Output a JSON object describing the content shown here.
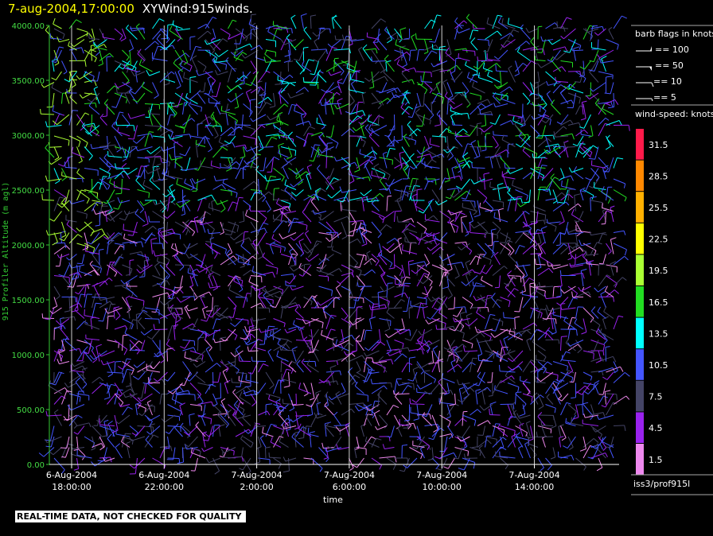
{
  "header": {
    "datetime": "7-aug-2004,17:00:00",
    "title": "XYWind:915winds."
  },
  "warning": "REAL-TIME DATA, NOT CHECKED FOR QUALITY",
  "station": "iss3/prof915l",
  "chart_data": {
    "type": "wind-barb",
    "xlabel": "time",
    "ylabel": "915 Profiler Altitude (m agl)",
    "ylim": [
      0,
      4000
    ],
    "y_ticks": [
      "0.00",
      "500.00",
      "1000.00",
      "1500.00",
      "2000.00",
      "2500.00",
      "3000.00",
      "3500.00",
      "4000.00"
    ],
    "x_ticks": [
      {
        "date": "6-Aug-2004",
        "time": "18:00:00"
      },
      {
        "date": "6-Aug-2004",
        "time": "22:00:00"
      },
      {
        "date": "7-Aug-2004",
        "time": "2:00:00"
      },
      {
        "date": "7-Aug-2004",
        "time": "6:00:00"
      },
      {
        "date": "7-Aug-2004",
        "time": "10:00:00"
      },
      {
        "date": "7-Aug-2004",
        "time": "14:00:00"
      }
    ],
    "barb_legend": {
      "title": "barb flags in knots",
      "entries": [
        "== 100",
        "== 50",
        "== 10",
        "== 5"
      ]
    },
    "speed_legend": {
      "title": "wind-speed: knots",
      "entries": [
        {
          "label": "31.5",
          "color": "#ff1a4a"
        },
        {
          "label": "28.5",
          "color": "#ff8800"
        },
        {
          "label": "25.5",
          "color": "#ffb000"
        },
        {
          "label": "22.5",
          "color": "#ffff00"
        },
        {
          "label": "19.5",
          "color": "#aaff33"
        },
        {
          "label": "16.5",
          "color": "#22dd22"
        },
        {
          "label": "13.5",
          "color": "#00ffff"
        },
        {
          "label": "10.5",
          "color": "#4455ff"
        },
        {
          "label": "7.5",
          "color": "#444466"
        },
        {
          "label": "4.5",
          "color": "#9922ee"
        },
        {
          "label": "1.5",
          "color": "#ee88ee"
        }
      ]
    }
  }
}
